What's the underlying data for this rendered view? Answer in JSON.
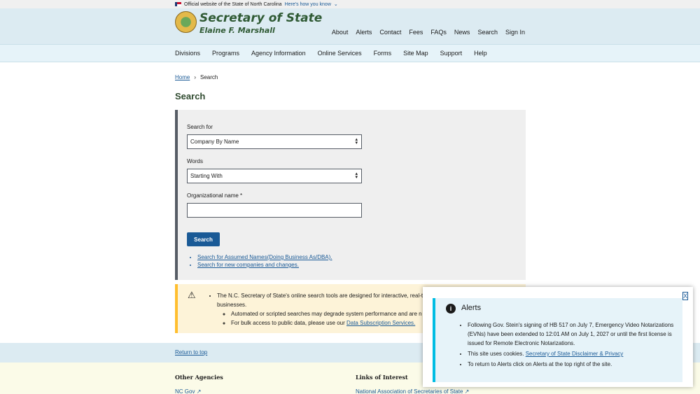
{
  "gov_banner": {
    "text": "Official website of the State of North Carolina",
    "how": "Here's how you know"
  },
  "header": {
    "title": "Secretary of State",
    "subtitle": "Elaine F. Marshall"
  },
  "util_nav": [
    "About",
    "Alerts",
    "Contact",
    "Fees",
    "FAQs",
    "News",
    "Search",
    "Sign In"
  ],
  "main_nav": [
    "Divisions",
    "Programs",
    "Agency Information",
    "Online Services",
    "Forms",
    "Site Map",
    "Support",
    "Help"
  ],
  "breadcrumb": {
    "home": "Home",
    "sep": "›",
    "current": "Search"
  },
  "page_title": "Search",
  "form": {
    "search_for_label": "Search for",
    "search_for_value": "Company By Name",
    "words_label": "Words",
    "words_value": "Starting With",
    "org_label": "Organizational name *",
    "org_value": "",
    "search_button": "Search",
    "link1": "Search for Assumed Names(Doing Business As/DBA).",
    "link2": "Search for new companies and changes."
  },
  "warning": {
    "text1": "The N.C. Secretary of State's online search tools are designed for interactive, real-t",
    "text1b": "businesses.",
    "sub1": "Automated or scripted searches may degrade system performance and are n",
    "sub2_prefix": "For bulk access to public data, please use our ",
    "sub2_link": "Data Subscription Services."
  },
  "return_top": "Return to top",
  "footer": {
    "other_agencies": "Other Agencies",
    "links_of_interest": "Links of Interest",
    "nc_gov": "NC Gov",
    "nass": "National Association of Secretaries of State"
  },
  "alerts_modal": {
    "close": "X",
    "title": "Alerts",
    "item1": "Following Gov. Stein's signing of HB 517 on July 7, Emergency Video Notarizations (EVNs) have been extended to 12:01 AM on July 1, 2027 or until the first license is issued for Remote Electronic Notarizations.",
    "item2_prefix": "This site uses cookies.  ",
    "item2_link": "Secretary of State Disclaimer & Privacy",
    "item3": "To return to Alerts click on Alerts at the top right of the site."
  }
}
